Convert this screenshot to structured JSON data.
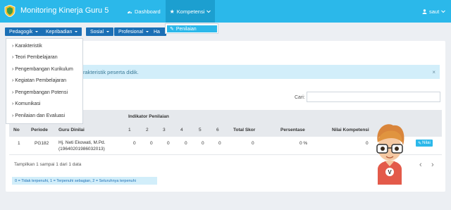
{
  "app": {
    "title": "Monitoring Kinerja Guru 5"
  },
  "nav": {
    "dashboard": "Dashboard",
    "kompetensi": "Kompetensi",
    "user": "saut"
  },
  "kompetensi_menu": {
    "penilaian": "Penilaian"
  },
  "subnav": {
    "pedagogik": "Pedagogik",
    "kepribadian": "Kepribadian",
    "sosial": "Sosial",
    "profesional": "Profesional",
    "ha": "Ha"
  },
  "pedagogik_menu": [
    "Karakteristik",
    "Teori Pembelajaran",
    "Pengembangan Kurikulum",
    "Kegiatan Pembelajaran",
    "Pengembangan Potensi",
    "Komunikasi",
    "Penilaian dan Evaluasi"
  ],
  "alert": {
    "text": "rakteristik peserta didik.",
    "close": "×"
  },
  "search": {
    "label": "Cari:",
    "value": ""
  },
  "table": {
    "group_header": "Indikator Penilaian",
    "headers": {
      "no": "No",
      "periode": "Periode",
      "guru": "Guru Dinilai",
      "i1": "1",
      "i2": "2",
      "i3": "3",
      "i4": "4",
      "i5": "5",
      "i6": "6",
      "total": "Total Skor",
      "persen": "Persentase",
      "nilai": "Nilai Kompetensi"
    },
    "row": {
      "no": "1",
      "periode": "PG182",
      "guru_name": "Hj. Neti Ekowati, M.Pd.",
      "guru_nip": "(19640201986032013)",
      "i1": "0",
      "i2": "0",
      "i3": "0",
      "i4": "0",
      "i5": "0",
      "i6": "0",
      "total": "0",
      "persen": "0 %",
      "nilai": "0",
      "action": "Nilai"
    }
  },
  "info": "Tampilkan 1 sampai 1 dari 1 data",
  "pager": {
    "prev": "‹",
    "next": "›"
  },
  "legend": "0 = Tidak terpenuhi, 1 = Terpenuhi sebagian, 2 = Seluruhnya terpenuhi",
  "mascot_badge": "V",
  "icons": {
    "dashboard": "dashboard-icon",
    "kompetensi": "star-icon",
    "penilaian": "edit-icon",
    "user": "user-icon",
    "nilai": "edit-icon"
  },
  "colors": {
    "navbar": "#2bb8ea",
    "pill": "#1b6fb5",
    "alert_bg": "#d2eefa"
  }
}
